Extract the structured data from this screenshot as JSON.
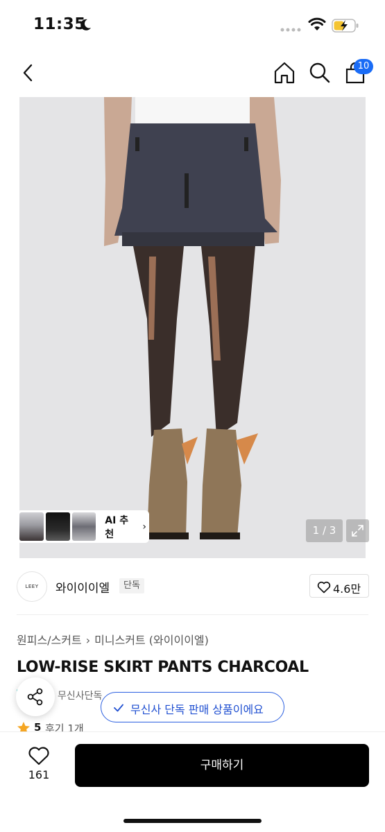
{
  "status_bar": {
    "time": "11:35",
    "icons": [
      "moon-icon",
      "signal-icon",
      "wifi-icon",
      "battery-charging-icon"
    ]
  },
  "nav": {
    "icons": [
      "back-icon",
      "home-icon",
      "search-icon",
      "cart-icon"
    ],
    "cart_badge": "10",
    "badge_color": "#1a6cf6"
  },
  "gallery": {
    "page_counter": "1 / 3",
    "ai_recommend_label": "AI 추천",
    "ai_recommend_chevron": "›",
    "thumbnail_count": 3
  },
  "brand": {
    "logo_text": "LEEY",
    "name": "와이이이엘",
    "tag": "단독",
    "like_count": "4.6만"
  },
  "product": {
    "breadcrumb": [
      "원피스/스커트",
      "미니스커트 (와이이이엘)"
    ],
    "breadcrumb_separator": "›",
    "title": "LOW-RISE SKIRT PANTS CHARCOAL",
    "exclusive_label": "무신사단독",
    "rating": "5",
    "review_count": "후기 1개"
  },
  "toast": {
    "text": "무신사 단독 판매 상품이에요",
    "color": "#2b5fe0"
  },
  "bottom_bar": {
    "like_count": "161",
    "buy_label": "구매하기"
  }
}
